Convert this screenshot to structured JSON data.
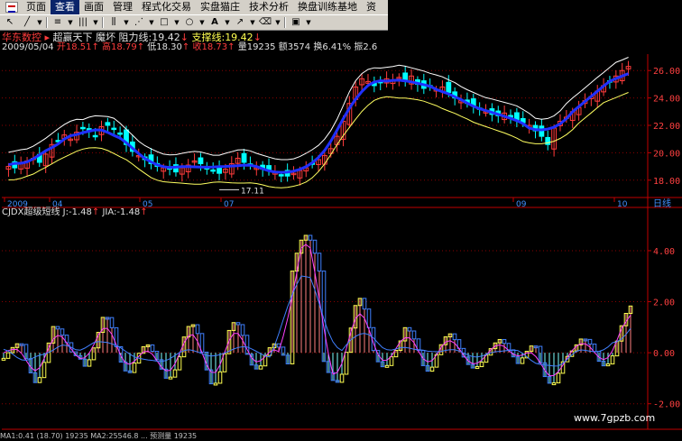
{
  "menu": {
    "items": [
      "页面",
      "查看",
      "画面",
      "管理",
      "程式化交易",
      "实盘猫庄",
      "技术分析",
      "换盘训练基地",
      "资"
    ],
    "active_index": 1
  },
  "toolbar": {
    "icons": [
      "cursor-icon",
      "line-draw-icon",
      "dropdown-icon",
      "channel-icon",
      "dropdown-icon",
      "parallel-lines-icon",
      "dropdown-icon",
      "fibonacci-icon",
      "dropdown-icon",
      "fan-icon",
      "dropdown-icon",
      "rectangle-icon",
      "dropdown-icon",
      "ellipse-icon",
      "dropdown-icon",
      "text-icon",
      "dropdown-icon",
      "arrow-icon",
      "dropdown-icon",
      "eraser-icon",
      "dropdown-icon",
      "save-icon",
      "dropdown-icon"
    ]
  },
  "stock": {
    "name": "华东数控",
    "indicator_name": "超赢天下",
    "mode": "魔坏",
    "resistance_label": "阻力线:",
    "resistance_value": "19.42",
    "support_label": "支撑线:",
    "support_value": "19.42"
  },
  "quote": {
    "date": "2009/05/04",
    "open_label": "开",
    "open": "18.51",
    "high_label": "高",
    "high": "18.79",
    "low_label": "低",
    "low": "18.30",
    "close_label": "收",
    "close": "18.73",
    "volume_label": "量",
    "volume": "19235",
    "amount_label": "额",
    "amount": "3574",
    "turnover_label": "换",
    "turnover": "6.41%",
    "amplitude_label": "振",
    "amplitude": "2.6"
  },
  "main_chart": {
    "y_ticks": [
      "26.00",
      "24.00",
      "22.00",
      "20.00",
      "18.00"
    ],
    "y_values": [
      26,
      24,
      22,
      20,
      18
    ],
    "x_labels": [
      "2009",
      "04",
      "05",
      "07",
      "09",
      "10"
    ],
    "period_label": "日线",
    "low_annotation": "17.11",
    "candles": [
      19,
      18.9,
      19.2,
      19.4,
      19.6,
      19.3,
      19.9,
      20.6,
      20.9,
      21.3,
      21,
      21.5,
      21.8,
      21.6,
      21.2,
      21.9,
      22,
      21.7,
      21.4,
      20.6,
      20.1,
      19.8,
      19.5,
      19.2,
      19,
      18.9,
      18.8,
      18.6,
      18.9,
      19.1,
      19.4,
      19.2,
      18.9,
      18.7,
      18.5,
      18.8,
      19.2,
      19.6,
      19.3,
      19.1,
      18.9,
      18.8,
      18.7,
      18.6,
      18.4,
      18.3,
      18.5,
      18.7,
      18.9,
      19.2,
      19.5,
      19.8,
      20.3,
      21.2,
      22.3,
      23.6,
      24.8,
      25.4,
      25.2,
      24.9,
      25.1,
      25.4,
      25.3,
      25.5,
      25.2,
      25.6,
      25,
      24.7,
      24.9,
      24.6,
      24.8,
      24.4,
      24,
      23.8,
      23.6,
      23.4,
      23.2,
      23,
      22.8,
      22.7,
      22.9,
      22.6,
      22.4,
      22.2,
      22,
      21.6,
      21.2,
      20.6,
      21.8,
      22.3,
      22.6,
      23,
      23.3,
      23.8,
      24.1,
      24.5,
      24.9,
      25.2,
      25.6,
      26,
      26.3
    ]
  },
  "indicator": {
    "name": "CJDX超级短线",
    "j_label": "J:",
    "j_value": "-1.48",
    "jia_label": "JIA:",
    "jia_value": "-1.48",
    "y_ticks": [
      "4.00",
      "2.00",
      "0.00",
      "-2.00"
    ],
    "y_values": [
      4,
      2,
      0,
      -2
    ]
  },
  "bottom_status": "MA1:0.41 (18.70) 19235 MA2:25546.8 ... 预测量 19235",
  "watermark": "www.7gpzb.com",
  "colors": {
    "up": "#ff3c3c",
    "down": "#00ffff",
    "grid": "#8b0000",
    "axis": "#c00000",
    "ma_blue": "#2030ff",
    "band_upper": "#ffffff",
    "band_lower": "#ffff60",
    "j_line": "#ffff50",
    "k_line": "#ff40ff",
    "d_line": "#4080ff"
  }
}
